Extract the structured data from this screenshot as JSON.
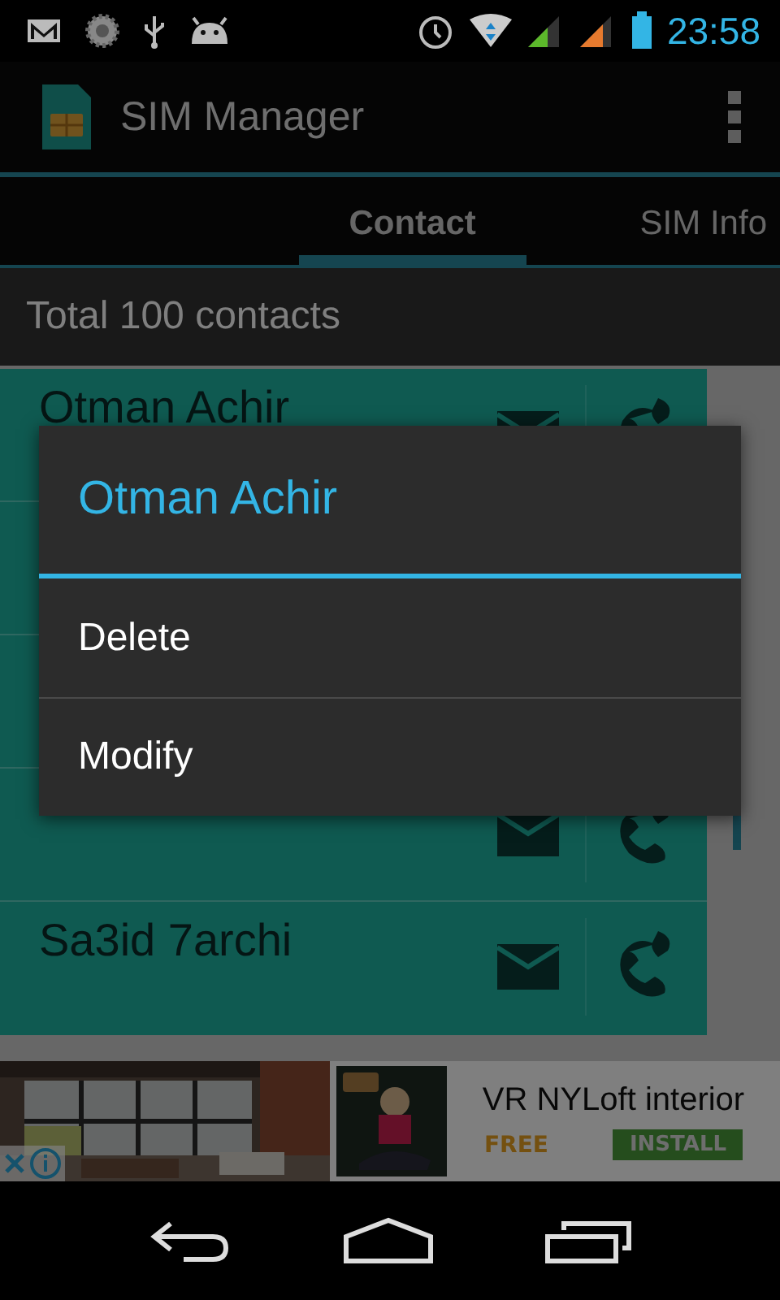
{
  "status_bar": {
    "time": "23:58"
  },
  "app_bar": {
    "title": "SIM Manager"
  },
  "tabs": [
    {
      "label": "Contact",
      "selected": true
    },
    {
      "label": "SIM Info",
      "selected": false
    }
  ],
  "summary": "Total 100 contacts",
  "contacts": [
    {
      "kind": "contact",
      "name": "Otman Achir"
    },
    {
      "kind": "covered"
    },
    {
      "kind": "covered"
    },
    {
      "kind": "icons"
    },
    {
      "kind": "contact",
      "name": "Sa3id 7archi"
    }
  ],
  "dialog": {
    "title": "Otman Achir",
    "items": [
      "Delete",
      "Modify"
    ]
  },
  "ad": {
    "title": "VR NYLoft interior",
    "price": "FREE",
    "action": "INSTALL"
  }
}
